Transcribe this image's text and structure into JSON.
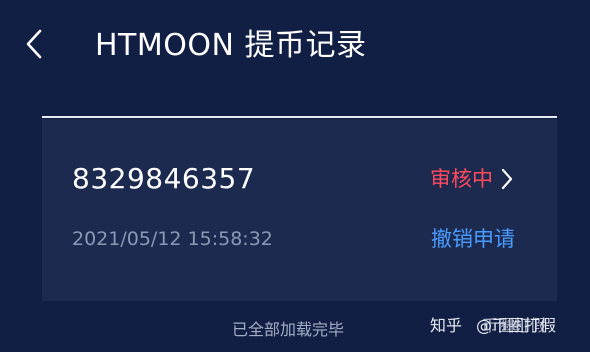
{
  "header": {
    "title": "HTMOON 提币记录"
  },
  "record": {
    "id": "8329846357",
    "status": "审核中",
    "timestamp": "2021/05/12 15:58:32",
    "cancel_label": "撤销申请"
  },
  "footer": {
    "text": "已全部加载完毕"
  },
  "watermark": {
    "site": "知乎",
    "author": "@币圈打假",
    "author_overlap": "币圈打假"
  },
  "colors": {
    "background": "#121f44",
    "card": "#1c2a4f",
    "status_red": "#ff4a5e",
    "link_blue": "#4a9bff"
  },
  "icons": {
    "back": "chevron-left-icon",
    "status_arrow": "chevron-right-icon"
  }
}
